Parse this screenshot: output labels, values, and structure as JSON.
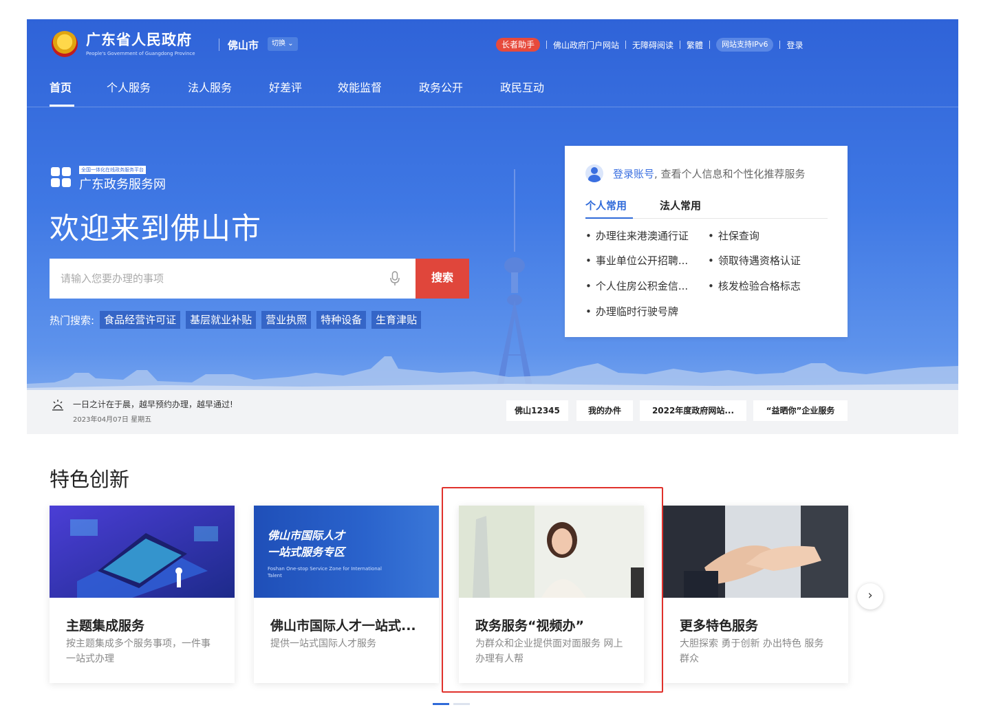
{
  "header": {
    "gov_title": "广东省人民政府",
    "gov_subtitle": "People's Government of Guangdong Province",
    "city": "佛山市",
    "switch_label": "切换",
    "utility": {
      "elder": "长者助手",
      "portal": "佛山政府门户网站",
      "accessible": "无障碍阅读",
      "traditional": "繁體",
      "ipv6": "网站支持IPv6",
      "login": "登录"
    }
  },
  "nav": [
    "首页",
    "个人服务",
    "法人服务",
    "好差评",
    "效能监督",
    "政务公开",
    "政民互动"
  ],
  "hero": {
    "platform_badge": "全国一体化在线政务服务平台",
    "platform_name": "广东政务服务网",
    "welcome": "欢迎来到佛山市",
    "search_placeholder": "请输入您要办理的事项",
    "search_button": "搜索",
    "hot_label": "热门搜索:",
    "hot_tags": [
      "食品经营许可证",
      "基层就业补贴",
      "营业执照",
      "特种设备",
      "生育津贴"
    ]
  },
  "login_card": {
    "link": "登录账号",
    "rest": ", 查看个人信息和个性化推荐服务",
    "tabs": [
      "个人常用",
      "法人常用"
    ],
    "items": [
      "办理往来港澳通行证",
      "社保查询",
      "事业单位公开招聘...",
      "领取待遇资格认证",
      "个人住房公积金信...",
      "核发检验合格标志",
      "办理临时行驶号牌"
    ]
  },
  "notice": {
    "text": "一日之计在于晨，越早预约办理，越早通过!",
    "date": "2023年04月07日 星期五",
    "buttons": [
      "佛山12345",
      "我的办件",
      "2022年度政府网站...",
      "“益晒你”企业服务"
    ]
  },
  "section": {
    "title": "特色创新",
    "cards": [
      {
        "title": "主题集成服务",
        "desc": "按主题集成多个服务事项，一件事一站式办理"
      },
      {
        "title": "佛山市国际人才一站式...",
        "desc": "提供一站式国际人才服务",
        "img_title_1": "佛山市国际人才",
        "img_title_2": "一站式服务专区",
        "img_sub": "Foshan One-stop Service Zone for International Talent"
      },
      {
        "title": "政务服务“视频办”",
        "desc": "为群众和企业提供面对面服务 网上办理有人帮"
      },
      {
        "title": "更多特色服务",
        "desc": "大胆探索 勇于创新 办出特色 服务群众"
      }
    ],
    "carousel": {
      "slides": 2,
      "active": 1
    }
  },
  "colors": {
    "primary": "#2f63d8",
    "accent_red": "#e0463b",
    "link_blue": "#3a6fe0",
    "highlight_red": "#e0312b"
  }
}
